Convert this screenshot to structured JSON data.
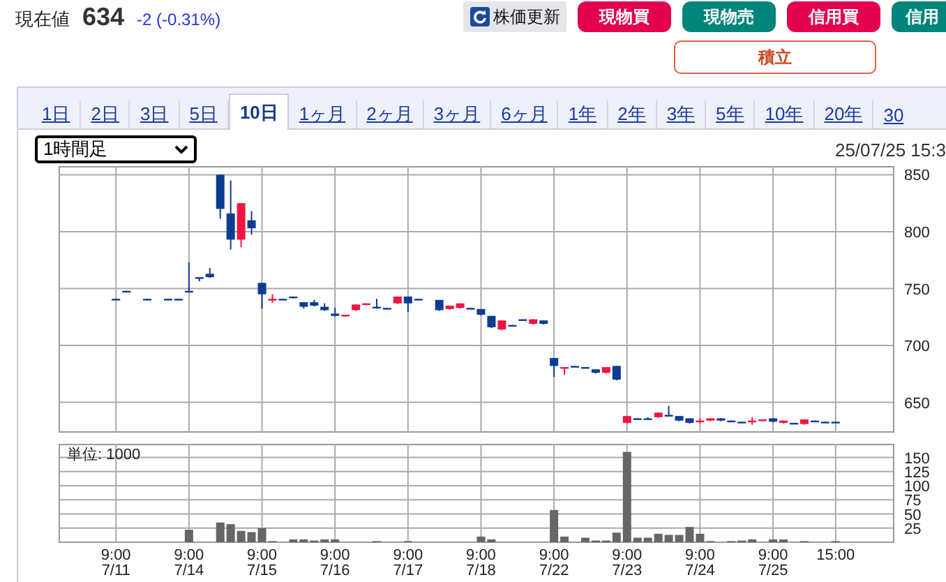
{
  "quote": {
    "label": "現在値",
    "price": "634",
    "change": "-2 (-0.31%)"
  },
  "buttons": [
    {
      "label": "株価更新",
      "kind": "refresh"
    },
    {
      "label": "現物買",
      "kind": "buy"
    },
    {
      "label": "現物売",
      "kind": "sell"
    },
    {
      "label": "信用買",
      "kind": "buy"
    },
    {
      "label": "信用",
      "kind": "sell"
    }
  ],
  "savings_button": "積立",
  "tabs": [
    {
      "label": "1日",
      "selected": false
    },
    {
      "label": "2日",
      "selected": false
    },
    {
      "label": "3日",
      "selected": false
    },
    {
      "label": "5日",
      "selected": false
    },
    {
      "label": "10日",
      "selected": true
    },
    {
      "label": "1ヶ月",
      "selected": false
    },
    {
      "label": "2ヶ月",
      "selected": false
    },
    {
      "label": "3ヶ月",
      "selected": false
    },
    {
      "label": "6ヶ月",
      "selected": false
    },
    {
      "label": "1年",
      "selected": false
    },
    {
      "label": "2年",
      "selected": false
    },
    {
      "label": "3年",
      "selected": false
    },
    {
      "label": "5年",
      "selected": false
    },
    {
      "label": "10年",
      "selected": false
    },
    {
      "label": "20年",
      "selected": false
    },
    {
      "label": "30",
      "selected": false
    }
  ],
  "interval_select": {
    "value": "1時間足"
  },
  "timestamp": "25/07/25 15:3",
  "price_chart": {
    "chart_data": {
      "type": "candlestick",
      "grid": true,
      "ylim": [
        624,
        857
      ],
      "yticks": [
        650,
        700,
        750,
        800,
        850
      ],
      "categories": [
        null,
        null,
        null,
        null,
        null,
        null,
        null,
        null,
        null,
        null,
        null,
        null,
        null,
        null,
        null,
        null,
        null,
        null,
        null,
        null,
        null,
        null,
        null,
        null,
        null,
        null,
        null,
        null,
        null,
        null,
        null,
        null,
        null,
        null,
        null,
        null,
        null,
        null,
        null,
        null,
        null,
        null,
        null,
        null,
        null,
        null,
        null,
        null,
        null,
        null,
        null,
        null,
        null,
        null,
        null,
        null,
        null,
        null,
        null,
        null,
        null,
        null,
        null,
        null,
        null,
        null,
        null,
        null,
        null,
        null,
        null,
        null,
        null,
        null,
        null
      ],
      "ohlc": [
        null,
        null,
        null,
        null,
        null,
        [
          741,
          741,
          741,
          741
        ],
        [
          748,
          748,
          748,
          748
        ],
        null,
        [
          741,
          741,
          741,
          741
        ],
        null,
        [
          741,
          741,
          741,
          741
        ],
        [
          741,
          741,
          741,
          741
        ],
        [
          748,
          773,
          748,
          748
        ],
        [
          760,
          760,
          757,
          759
        ],
        [
          763,
          768,
          760,
          760
        ],
        [
          850,
          850,
          812,
          820
        ],
        [
          816,
          845,
          785,
          793
        ],
        [
          793,
          825,
          787,
          825
        ],
        [
          810,
          818,
          798,
          803
        ],
        [
          755,
          755,
          733,
          745
        ],
        [
          740,
          745,
          738,
          741
        ],
        [
          741,
          741,
          741,
          741
        ],
        [
          743,
          743,
          742,
          742
        ],
        [
          738,
          738,
          733,
          734
        ],
        [
          738,
          740,
          735,
          735
        ],
        [
          734,
          737,
          731,
          731
        ],
        [
          728,
          733,
          726,
          726
        ],
        [
          726,
          727,
          726,
          727
        ],
        [
          731,
          736,
          731,
          736
        ],
        [
          736,
          737,
          736,
          737
        ],
        [
          734,
          741,
          733,
          734
        ],
        [
          733,
          733,
          733,
          733
        ],
        [
          737,
          743,
          737,
          743
        ],
        [
          743,
          743,
          730,
          737
        ],
        [
          741,
          741,
          741,
          741
        ],
        null,
        [
          740,
          740,
          731,
          731
        ],
        [
          732,
          735,
          732,
          735
        ],
        [
          733,
          737,
          733,
          737
        ],
        [
          733,
          733,
          733,
          733
        ],
        [
          732,
          732,
          727,
          727
        ],
        [
          726,
          726,
          716,
          716
        ],
        [
          714,
          722,
          714,
          722
        ],
        [
          718,
          718,
          718,
          718
        ],
        [
          723,
          723,
          723,
          723
        ],
        [
          719,
          723,
          719,
          723
        ],
        [
          722,
          722,
          719,
          719
        ],
        [
          689,
          689,
          673,
          682
        ],
        [
          680,
          681,
          675,
          681
        ],
        [
          682,
          682,
          682,
          682
        ],
        [
          681,
          681,
          681,
          681
        ],
        [
          679,
          679,
          676,
          676
        ],
        [
          676,
          681,
          676,
          681
        ],
        [
          682,
          682,
          670,
          670
        ],
        [
          632,
          638,
          632,
          638
        ],
        [
          636,
          636,
          636,
          636
        ],
        [
          636,
          637,
          636,
          636
        ],
        [
          637,
          641,
          637,
          641
        ],
        [
          639,
          647,
          639,
          639
        ],
        [
          638,
          638,
          634,
          634
        ],
        [
          636,
          636,
          632,
          632
        ],
        [
          633,
          636,
          632,
          634
        ],
        [
          634,
          636,
          634,
          636
        ],
        [
          636,
          636,
          634,
          634
        ],
        [
          634,
          634,
          634,
          634
        ],
        [
          633,
          633,
          633,
          633
        ],
        [
          633,
          637,
          631,
          634
        ],
        [
          634,
          635,
          634,
          635
        ],
        [
          636,
          636,
          633,
          633
        ],
        [
          632,
          634,
          632,
          634
        ],
        [
          632,
          632,
          632,
          632
        ],
        [
          631,
          635,
          631,
          635
        ],
        [
          634,
          634,
          634,
          634
        ],
        [
          633,
          633,
          633,
          633
        ],
        [
          633,
          633,
          633,
          633
        ]
      ]
    }
  },
  "volume_chart": {
    "chart_data": {
      "type": "bar",
      "ylabel": "単位: 1000",
      "grid": true,
      "ylim": [
        0,
        173
      ],
      "categories": [
        null,
        null,
        null,
        null,
        null,
        "9:00\n7/11",
        null,
        null,
        null,
        null,
        null,
        null,
        "9:00\n7/14",
        null,
        null,
        null,
        null,
        null,
        null,
        "9:00\n7/15",
        null,
        null,
        null,
        null,
        null,
        null,
        "9:00\n7/16",
        null,
        null,
        null,
        null,
        null,
        null,
        "9:00\n7/17",
        null,
        null,
        null,
        null,
        null,
        null,
        "9:00\n7/18",
        null,
        null,
        null,
        null,
        null,
        null,
        "9:00\n7/22",
        null,
        null,
        null,
        null,
        null,
        null,
        "9:00\n7/23",
        null,
        null,
        null,
        null,
        null,
        null,
        "9:00\n7/24",
        null,
        null,
        null,
        null,
        null,
        null,
        "9:00\n7/25",
        null,
        null,
        null,
        null,
        null,
        "15:00"
      ],
      "values": [
        0,
        0,
        0,
        0,
        0,
        0,
        0,
        0,
        0,
        0,
        0,
        0,
        22,
        0,
        0,
        35,
        32,
        20,
        18,
        25,
        2,
        0,
        5,
        5,
        3,
        5,
        5,
        0,
        0,
        0,
        2,
        0,
        0,
        2,
        0,
        0,
        0,
        0,
        0,
        0,
        10,
        5,
        0,
        0,
        0,
        0,
        0,
        57,
        10,
        0,
        8,
        3,
        3,
        17,
        160,
        8,
        8,
        15,
        13,
        13,
        27,
        15,
        2,
        0,
        2,
        3,
        5,
        0,
        5,
        5,
        0,
        2,
        0,
        0,
        2
      ],
      "yticks": [
        25,
        50,
        75,
        100,
        125,
        150
      ]
    }
  }
}
